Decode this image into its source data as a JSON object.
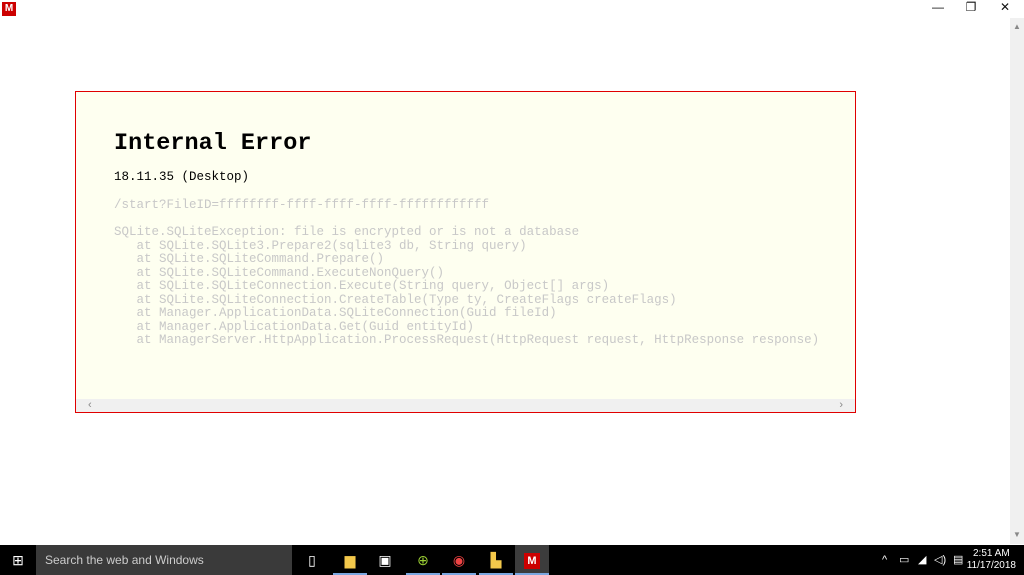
{
  "window": {
    "app_icon_letter": "M",
    "minimize": "—",
    "restore": "❐",
    "close": "✕"
  },
  "error": {
    "title": "Internal Error",
    "version": "18.11.35 (Desktop)",
    "url": "/start?FileID=ffffffff-ffff-ffff-ffff-ffffffffffff",
    "trace": [
      "SQLite.SQLiteException: file is encrypted or is not a database",
      "   at SQLite.SQLite3.Prepare2(sqlite3 db, String query)",
      "   at SQLite.SQLiteCommand.Prepare()",
      "   at SQLite.SQLiteCommand.ExecuteNonQuery()",
      "   at SQLite.SQLiteConnection.Execute(String query, Object[] args)",
      "   at SQLite.SQLiteConnection.CreateTable(Type ty, CreateFlags createFlags)",
      "   at Manager.ApplicationData.SQLiteConnection(Guid fileId)",
      "   at Manager.ApplicationData.Get(Guid entityId)",
      "   at ManagerServer.HttpApplication.ProcessRequest(HttpRequest request, HttpResponse response)"
    ]
  },
  "taskbar": {
    "search_placeholder": "Search the web and Windows",
    "time": "2:51 AM",
    "date": "11/17/2018",
    "app_letter": "M"
  }
}
